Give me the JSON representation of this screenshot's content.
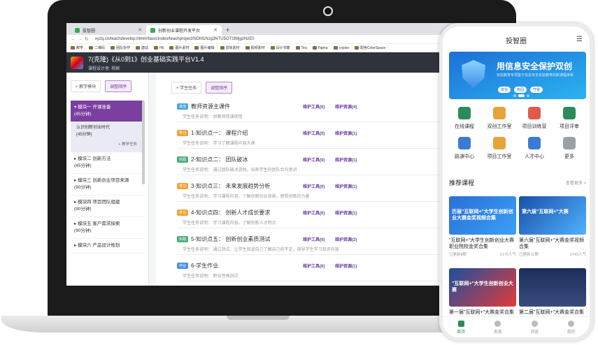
{
  "browser": {
    "tabs": [
      {
        "label": "投智圈"
      },
      {
        "label": "创新创业课程开发平台"
      }
    ],
    "new_tab": "+",
    "url": "xyzq.cn/teachdevelop.html#/basicIndex/teachproject/NDM1Nzg3NTU5OTI3MjgzNzE0",
    "bookmarks": [
      "教学",
      "二维码",
      "团队协作",
      "建站",
      "H5",
      "图片素材",
      "图片编辑",
      "音效素材",
      "视频素材",
      "设计书籍",
      "Teq",
      "Figma",
      "copies",
      "配色ColorSpace -"
    ]
  },
  "app": {
    "title": "7(克隆)《从0到1》创业基础实践平台V1.4",
    "designer": "课程设计者:  杨柳"
  },
  "left_panel": {
    "teach_module_btn": "+ 教学模块",
    "reorder_btn": "调整顺序",
    "active_module": {
      "title": "▾ 模块一 开课准备",
      "duration": "(45分钟)"
    },
    "active_sub": {
      "title": "认识创新创业时代",
      "duration": "(45分钟)",
      "add": "+ 教学任务"
    },
    "modules": [
      {
        "title": "▸ 模块二 创新方法",
        "duration": "(45分钟)"
      },
      {
        "title": "▸ 模块三 创新创业项目来源",
        "duration": "(90分钟)"
      },
      {
        "title": "▸ 模块四 项目团队组建",
        "duration": "(90分钟)"
      },
      {
        "title": "▸ 模块五 客户需求探索",
        "duration": "(90分钟)"
      },
      {
        "title": "▸ 模块六 产品设计规划",
        "duration": ""
      }
    ]
  },
  "main_panel": {
    "student_task_btn": "+ 学生任务",
    "reorder_btn": "调整顺序",
    "lessons": [
      {
        "tag": "其他",
        "title": "教师资源主课件",
        "tool": "维护工具(0)",
        "res": "维护资源(4)",
        "desc": "学生任务说明： 供教师授课使用"
      },
      {
        "tag": "学习",
        "title": "1-知识点一： 课程介绍",
        "tool": "维护工具(0)",
        "res": "维护资源(1)",
        "desc": "学生任务说明： 学习了解课程内容大纲"
      },
      {
        "tag": "实践",
        "title": "2-知识点二： 团队破冰",
        "tool": "维护工具(0)",
        "res": "维护资源(1)",
        "desc": "学生任务说明： 通过团队破冰游戏，培养学生的团队合作意识"
      },
      {
        "tag": "学习",
        "title": "3-知识点三： 未来发展趋势分析",
        "tool": "维护工具(0)",
        "res": "维护资源(1)",
        "desc": "学生任务说明： 学习课程内容，了解创新创业背景，感受创新的力量"
      },
      {
        "tag": "学习",
        "title": "4-知识点四： 创新人才成长要求",
        "tool": "维护工具(0)",
        "res": "维护资源(1)",
        "desc": "学生任务说明： 学习课程内容，了解创新人才特点"
      },
      {
        "tag": "实践",
        "title": "5-知识点五： 创新创业素质测试",
        "tool": "维护工具(0)",
        "res": "维护资源(2)",
        "desc": "学生任务说明： 通过测试，让学生知道自己了解自己的不足，指导学生学习知识内容"
      },
      {
        "tag": "作业",
        "title": "6-学生作业",
        "tool": "维护工具(0)",
        "res": "维护资源(1)",
        "desc": "学生任务说明： 职业性格测试"
      }
    ]
  },
  "phone": {
    "title": "投智圈",
    "banner": {
      "title": "用信息安全保护双创",
      "subtitle": "实验教育专项基于信息安全实验教育的新课程体系",
      "pills": [
        "安全",
        "校园",
        "守家"
      ]
    },
    "grid": [
      {
        "label": "在线课程",
        "icon": "book-icon"
      },
      {
        "label": "双创工作室",
        "icon": "studio-icon"
      },
      {
        "label": "项目训练营",
        "icon": "camp-icon"
      },
      {
        "label": "项目评审",
        "icon": "review-icon"
      },
      {
        "label": "路演中心",
        "icon": "mic-icon"
      },
      {
        "label": "项目工作室",
        "icon": "briefcase-icon"
      },
      {
        "label": "人才中心",
        "icon": "person-icon"
      },
      {
        "label": "更多",
        "icon": "more-icon"
      }
    ],
    "recommend": {
      "title": "推荐课程",
      "more": "查看更多 >"
    },
    "cards": [
      {
        "img_text": "历届\"互联网+\"大学生创新创业大赛金奖视频合集",
        "title": "\"互联网+\"大学生创新创业大赛职业院校金奖合集",
        "meta_left": "已更新8期",
        "meta_right": "2175人气"
      },
      {
        "img_text": "第六届\"互联网+\"大赛",
        "title": "第六届\"互联网+\"大赛金奖视频合集",
        "meta_left": "已更新11期",
        "meta_right": "2743人气"
      },
      {
        "img_text": "\"互联网+\"大学生创新创业大赛",
        "title": "第一届\"互联网+\"大赛金奖合集",
        "meta_left": "",
        "meta_right": ""
      },
      {
        "img_text": "",
        "title": "第二届\"互联网+\"大赛金奖合集",
        "meta_left": "",
        "meta_right": ""
      }
    ],
    "nav": [
      "首页",
      "发现",
      "消息",
      "我的"
    ]
  }
}
